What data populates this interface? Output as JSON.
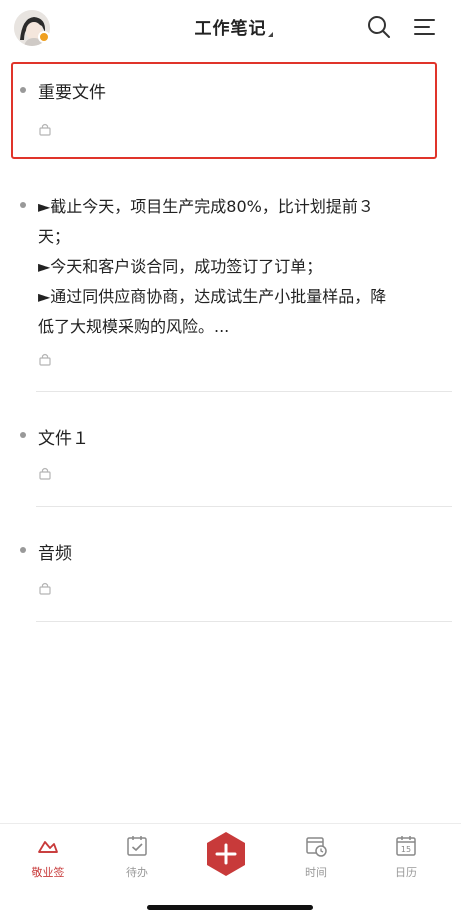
{
  "header": {
    "title": "工作笔记"
  },
  "notes": [
    {
      "title": "重要文件"
    },
    {
      "lines": [
        "►截止今天，项目生产完成80%，比计划提前３",
        "天；",
        "►今天和客户谈合同，成功签订了订单；",
        "►通过同供应商协商，达成试生产小批量样品，降",
        "低了大规模采购的风险。..."
      ]
    },
    {
      "title": "文件１"
    },
    {
      "title": "音频"
    }
  ],
  "tabbar": {
    "items": [
      {
        "label": "敬业签"
      },
      {
        "label": "待办"
      },
      {
        "label": "时间"
      },
      {
        "label": "日历"
      }
    ],
    "calendar_day": "15"
  },
  "colors": {
    "accent": "#c83a3a",
    "highlight": "#e0342a"
  }
}
